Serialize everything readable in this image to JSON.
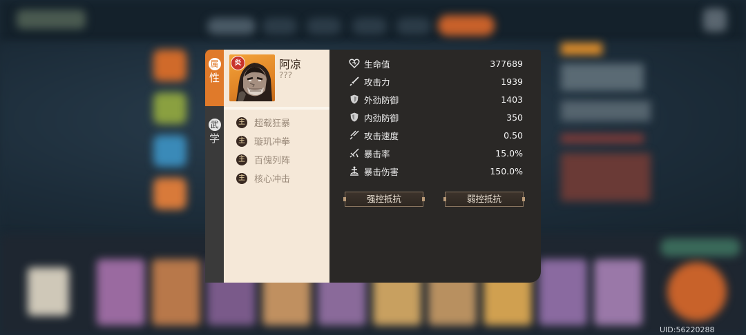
{
  "hero": {
    "name": "阿凉",
    "title": "???",
    "element": "炎"
  },
  "tabs": [
    {
      "label_top": "属",
      "label_bottom": "性",
      "active": true
    },
    {
      "label_top": "武",
      "label_bottom": "学",
      "active": false
    }
  ],
  "skills": [
    {
      "icon_text": "主",
      "label": "超载狂暴"
    },
    {
      "icon_text": "主",
      "label": "璇玑冲拳"
    },
    {
      "icon_text": "主",
      "label": "百傀列阵"
    },
    {
      "icon_text": "主",
      "label": "核心冲击"
    }
  ],
  "stats": [
    {
      "icon": "heart-icon",
      "label": "生命值",
      "value": "377689"
    },
    {
      "icon": "sword-icon",
      "label": "攻击力",
      "value": "1939"
    },
    {
      "icon": "shield-icon",
      "label": "外劲防御",
      "value": "1403"
    },
    {
      "icon": "shield-icon",
      "label": "内劲防御",
      "value": "350"
    },
    {
      "icon": "speed-icon",
      "label": "攻击速度",
      "value": "0.50"
    },
    {
      "icon": "crit-icon",
      "label": "暴击率",
      "value": "15.0%"
    },
    {
      "icon": "crit-damage-icon",
      "label": "暴击伤害",
      "value": "150.0%"
    }
  ],
  "buttons": {
    "strong_resist": "强控抵抗",
    "weak_resist": "弱控抵抗"
  },
  "uid": "UID:56220288",
  "colors": {
    "accent_orange": "#e07a2a",
    "panel_cream": "#f5e8d8",
    "panel_dark": "#2a2826"
  }
}
